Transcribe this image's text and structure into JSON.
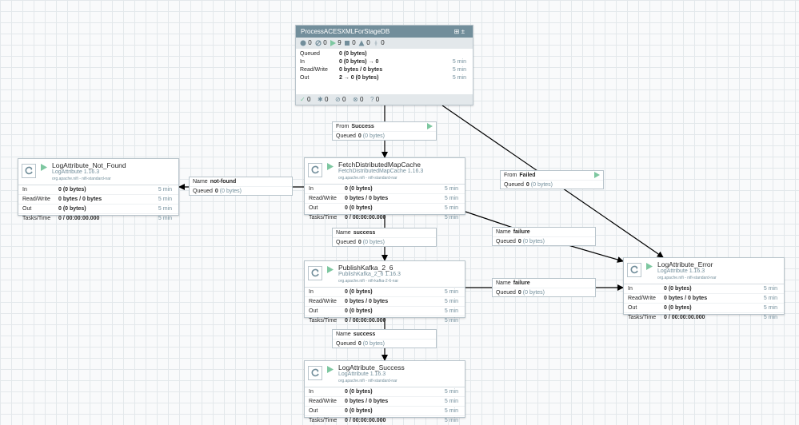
{
  "process_group": {
    "name": "ProcessACESXMLForStageDB",
    "stats": [
      "0",
      "0",
      "9",
      "0",
      "0",
      "0"
    ],
    "queued": {
      "label": "Queued",
      "value": "0 (0 bytes)",
      "time": ""
    },
    "in": {
      "label": "In",
      "value": "0 (0 bytes) → 0",
      "time": "5 min"
    },
    "rw": {
      "label": "Read/Write",
      "value": "0 bytes / 0 bytes",
      "time": "5 min"
    },
    "out": {
      "label": "Out",
      "value": "2 → 0 (0 bytes)",
      "time": "5 min"
    },
    "footer": [
      "0",
      "0",
      "0",
      "0",
      "0"
    ]
  },
  "processors": {
    "notfound": {
      "name": "LogAttribute_Not_Found",
      "type": "LogAttribute 1.16.3",
      "bundle": "org.apache.nifi - nifi-standard-nar",
      "in": "0 (0 bytes)",
      "rw": "0 bytes / 0 bytes",
      "out": "0 (0 bytes)",
      "tasks": "0 / 00:00:00.000"
    },
    "fetch": {
      "name": "FetchDistributedMapCache",
      "type": "FetchDistributedMapCache 1.16.3",
      "bundle": "org.apache.nifi - nifi-standard-nar",
      "in": "0 (0 bytes)",
      "rw": "0 bytes / 0 bytes",
      "out": "0 (0 bytes)",
      "tasks": "0 / 00:00:00.000"
    },
    "kafka": {
      "name": "PublishKafka_2_6",
      "type": "PublishKafka_2_6 1.16.3",
      "bundle": "org.apache.nifi - nifi-kafka-2-6-nar",
      "in": "0 (0 bytes)",
      "rw": "0 bytes / 0 bytes",
      "out": "0 (0 bytes)",
      "tasks": "0 / 00:00:00.000"
    },
    "success": {
      "name": "LogAttribute_Success",
      "type": "LogAttribute 1.16.3",
      "bundle": "org.apache.nifi - nifi-standard-nar",
      "in": "0 (0 bytes)",
      "rw": "0 bytes / 0 bytes",
      "out": "0 (0 bytes)",
      "tasks": "0 / 00:00:00.000"
    },
    "error": {
      "name": "LogAttribute_Error",
      "type": "LogAttribute 1.16.3",
      "bundle": "org.apache.nifi - nifi-standard-nar",
      "in": "0 (0 bytes)",
      "rw": "0 bytes / 0 bytes",
      "out": "0 (0 bytes)",
      "tasks": "0 / 00:00:00.000"
    }
  },
  "row_labels": {
    "in": "In",
    "rw": "Read/Write",
    "out": "Out",
    "tasks": "Tasks/Time",
    "time": "5 min"
  },
  "connections": {
    "from_success": {
      "k1": "From",
      "v1": "Success",
      "k2": "Queued",
      "v2": "0",
      "v2b": "(0 bytes)"
    },
    "from_failed": {
      "k1": "From",
      "v1": "Failed",
      "k2": "Queued",
      "v2": "0",
      "v2b": "(0 bytes)"
    },
    "not_found": {
      "k1": "Name",
      "v1": "not-found",
      "k2": "Queued",
      "v2": "0",
      "v2b": "(0 bytes)"
    },
    "fetch_success": {
      "k1": "Name",
      "v1": "success",
      "k2": "Queued",
      "v2": "0",
      "v2b": "(0 bytes)"
    },
    "fetch_failure": {
      "k1": "Name",
      "v1": "failure",
      "k2": "Queued",
      "v2": "0",
      "v2b": "(0 bytes)"
    },
    "kafka_failure": {
      "k1": "Name",
      "v1": "failure",
      "k2": "Queued",
      "v2": "0",
      "v2b": "(0 bytes)"
    },
    "kafka_success": {
      "k1": "Name",
      "v1": "success",
      "k2": "Queued",
      "v2": "0",
      "v2b": "(0 bytes)"
    }
  },
  "colors": {
    "accent": "#728e9b",
    "running": "#7dc7a0",
    "grid": "#e3e8eb",
    "edge": "#000000"
  }
}
